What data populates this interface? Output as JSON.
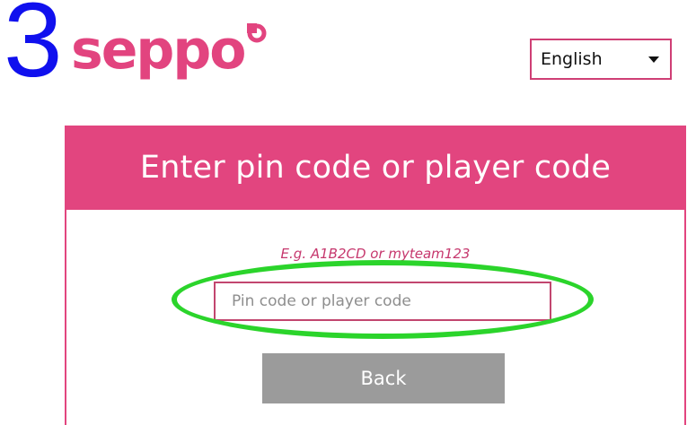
{
  "annotation": {
    "step_number": "3",
    "highlight_color": "#2bd42b"
  },
  "logo": {
    "text": "seppo",
    "brand_color": "#e2447f"
  },
  "language_select": {
    "selected": "English",
    "icon": "caret-down-icon"
  },
  "card": {
    "title": "Enter pin code or player code",
    "hint": "E.g. A1B2CD or myteam123",
    "input": {
      "value": "",
      "placeholder": "Pin code or player code"
    },
    "back_label": "Back"
  },
  "colors": {
    "accent": "#e2457f",
    "button_gray": "#9b9b9b"
  }
}
